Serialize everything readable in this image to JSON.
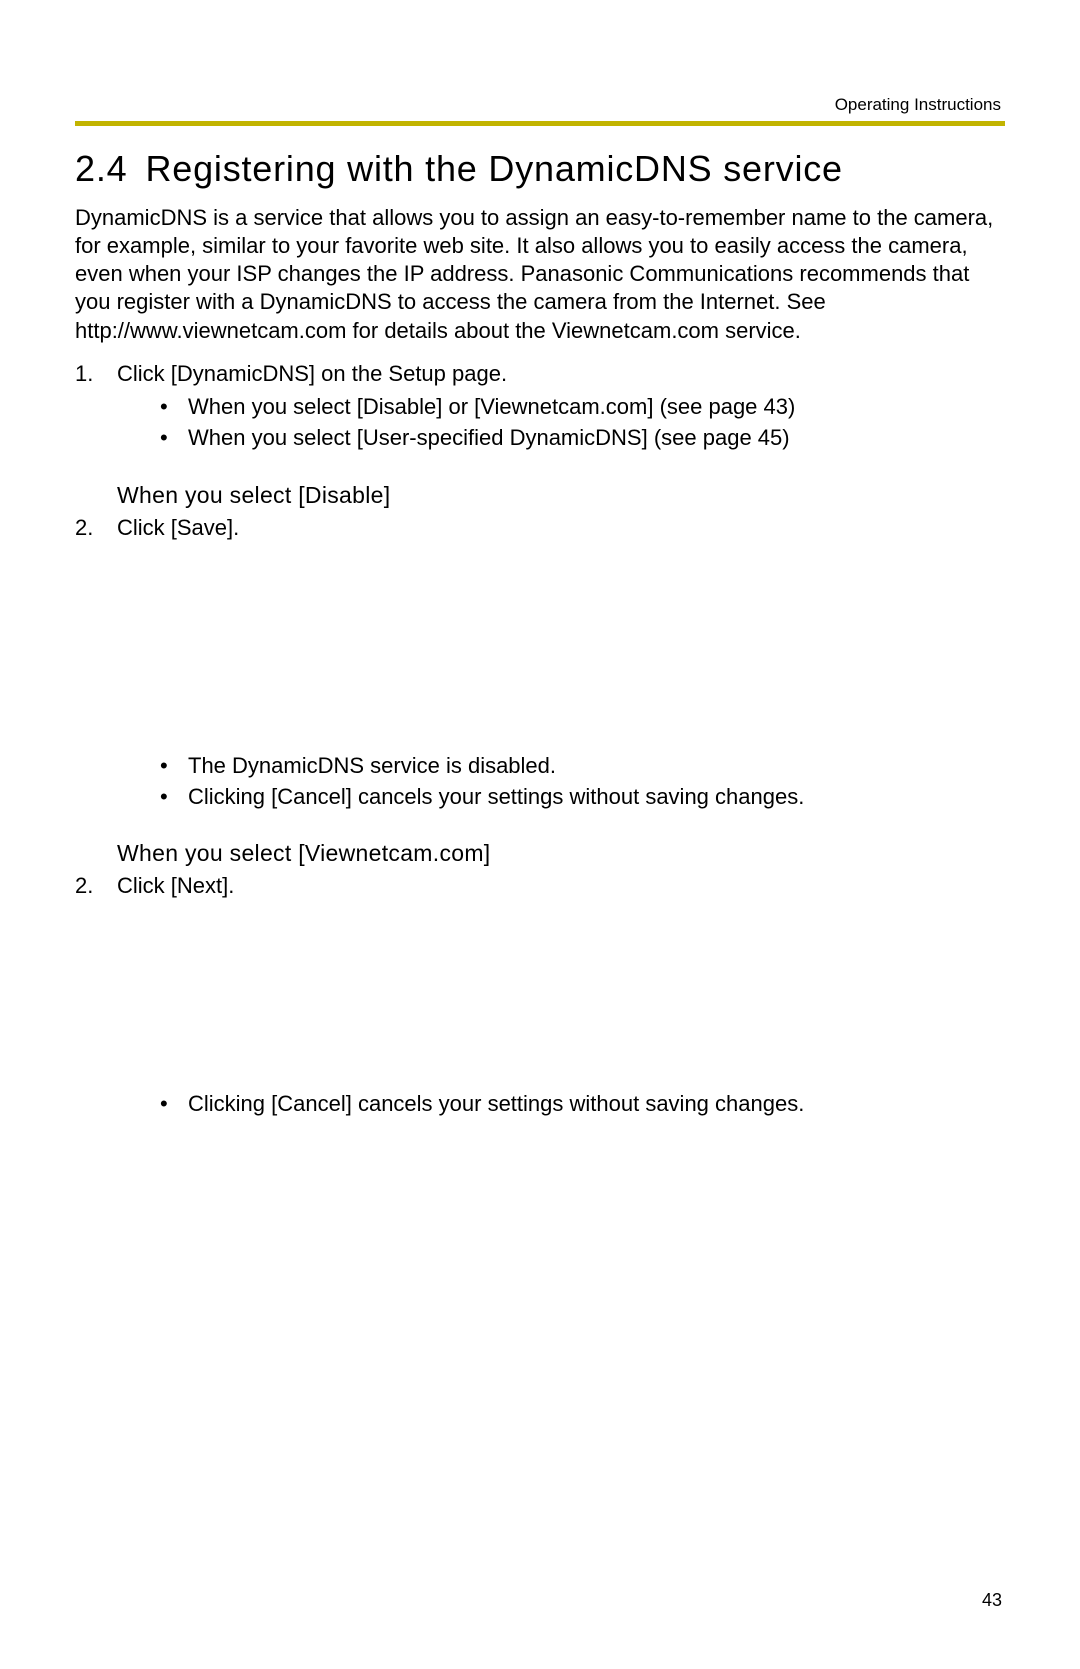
{
  "header": {
    "doc_label": "Operating Instructions"
  },
  "section": {
    "number": "2.4",
    "title": "Registering with the DynamicDNS service"
  },
  "intro": "DynamicDNS is a service that allows you to assign an easy-to-remember name to the camera, for example, similar to your favorite web site. It also allows you to easily access the camera, even when your ISP changes the IP address. Panasonic Communications recommends that you register with a DynamicDNS to access the camera from the Internet. See http://www.viewnetcam.com for details about the Viewnetcam.com service.",
  "step1": {
    "marker": "1.",
    "text": "Click [DynamicDNS] on the Setup page.",
    "sub": [
      "When you select [Disable] or [Viewnetcam.com] (see page 43)",
      "When you select [User-specified DynamicDNS] (see page 45)"
    ]
  },
  "disable_block": {
    "heading": "When you select [Disable]",
    "step_marker": "2.",
    "step_text": "Click [Save].",
    "notes": [
      "The DynamicDNS service is disabled.",
      "Clicking [Cancel] cancels your settings without saving changes."
    ]
  },
  "viewnetcam_block": {
    "heading": "When you select [Viewnetcam.com]",
    "step_marker": "2.",
    "step_text": "Click [Next].",
    "notes": [
      "Clicking [Cancel] cancels your settings without saving changes."
    ]
  },
  "page_number": "43",
  "bullet_glyph": "•"
}
